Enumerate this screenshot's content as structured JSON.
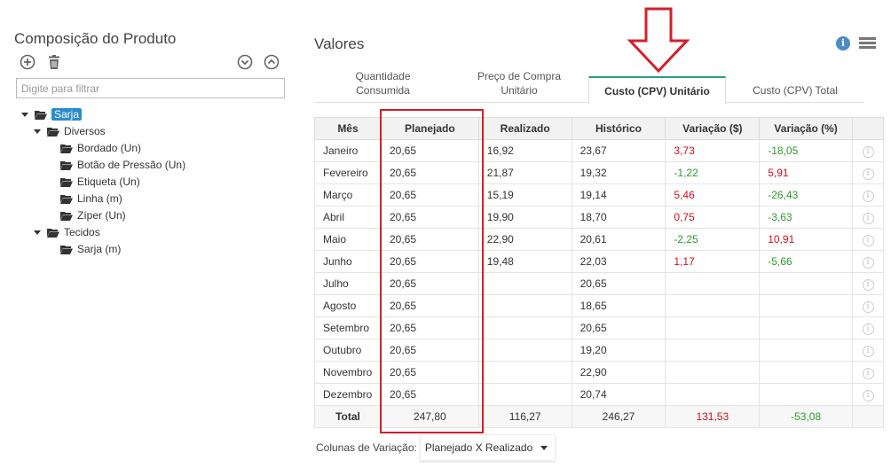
{
  "left_panel": {
    "title": "Composição do Produto",
    "filter_placeholder": "Digite para filtrar",
    "tree": {
      "root": "Sarja",
      "groups": [
        {
          "label": "Diversos",
          "items": [
            "Bordado (Un)",
            "Botão de Pressão (Un)",
            "Etiqueta (Un)",
            "Linha (m)",
            "Zíper (Un)"
          ]
        },
        {
          "label": "Tecidos",
          "items": [
            "Sarja (m)"
          ]
        }
      ]
    }
  },
  "right_panel": {
    "title": "Valores",
    "tabs": [
      {
        "label": "Quantidade\nConsumida",
        "active": false
      },
      {
        "label": "Preço de Compra\nUnitário",
        "active": false
      },
      {
        "label": "Custo (CPV) Unitário",
        "active": true
      },
      {
        "label": "Custo (CPV) Total",
        "active": false
      }
    ],
    "table": {
      "headers": [
        "Mês",
        "Planejado",
        "Realizado",
        "Histórico",
        "Variação ($)",
        "Variação (%)"
      ],
      "rows": [
        {
          "mes": "Janeiro",
          "planejado": "20,65",
          "realizado": "16,92",
          "historico": "23,67",
          "var_r": "3,73",
          "var_r_color": "red",
          "var_p": "-18,05",
          "var_p_color": "green"
        },
        {
          "mes": "Fevereiro",
          "planejado": "20,65",
          "realizado": "21,87",
          "historico": "19,32",
          "var_r": "-1,22",
          "var_r_color": "green",
          "var_p": "5,91",
          "var_p_color": "red"
        },
        {
          "mes": "Março",
          "planejado": "20,65",
          "realizado": "15,19",
          "historico": "19,14",
          "var_r": "5,46",
          "var_r_color": "red",
          "var_p": "-26,43",
          "var_p_color": "green"
        },
        {
          "mes": "Abril",
          "planejado": "20,65",
          "realizado": "19,90",
          "historico": "18,70",
          "var_r": "0,75",
          "var_r_color": "red",
          "var_p": "-3,63",
          "var_p_color": "green"
        },
        {
          "mes": "Maio",
          "planejado": "20,65",
          "realizado": "22,90",
          "historico": "20,61",
          "var_r": "-2,25",
          "var_r_color": "green",
          "var_p": "10,91",
          "var_p_color": "red"
        },
        {
          "mes": "Junho",
          "planejado": "20,65",
          "realizado": "19,48",
          "historico": "22,03",
          "var_r": "1,17",
          "var_r_color": "red",
          "var_p": "-5,66",
          "var_p_color": "green"
        },
        {
          "mes": "Julho",
          "planejado": "20,65",
          "realizado": "",
          "historico": "20,65",
          "var_r": "",
          "var_r_color": "",
          "var_p": "",
          "var_p_color": ""
        },
        {
          "mes": "Agosto",
          "planejado": "20,65",
          "realizado": "",
          "historico": "18,65",
          "var_r": "",
          "var_r_color": "",
          "var_p": "",
          "var_p_color": ""
        },
        {
          "mes": "Setembro",
          "planejado": "20,65",
          "realizado": "",
          "historico": "20,65",
          "var_r": "",
          "var_r_color": "",
          "var_p": "",
          "var_p_color": ""
        },
        {
          "mes": "Outubro",
          "planejado": "20,65",
          "realizado": "",
          "historico": "19,20",
          "var_r": "",
          "var_r_color": "",
          "var_p": "",
          "var_p_color": ""
        },
        {
          "mes": "Novembro",
          "planejado": "20,65",
          "realizado": "",
          "historico": "22,90",
          "var_r": "",
          "var_r_color": "",
          "var_p": "",
          "var_p_color": ""
        },
        {
          "mes": "Dezembro",
          "planejado": "20,65",
          "realizado": "",
          "historico": "20,74",
          "var_r": "",
          "var_r_color": "",
          "var_p": "",
          "var_p_color": ""
        }
      ],
      "total": {
        "label": "Total",
        "planejado": "247,80",
        "realizado": "116,27",
        "historico": "246,27",
        "var_r": "131,53",
        "var_r_color": "red",
        "var_p": "-53,08",
        "var_p_color": "green"
      }
    },
    "footer": {
      "label": "Colunas de Variação:",
      "selected": "Planejado X Realizado"
    }
  },
  "colors": {
    "accent": "#2aa07a",
    "selection": "#2a8ccc",
    "highlight": "#d41f2a",
    "negative": "#d0101e",
    "positive": "#2c9a2c"
  },
  "icons": [
    "add-circle-icon",
    "trash-icon",
    "expand-all-icon",
    "collapse-all-icon",
    "info-icon",
    "menu-icon",
    "row-info-icon"
  ]
}
